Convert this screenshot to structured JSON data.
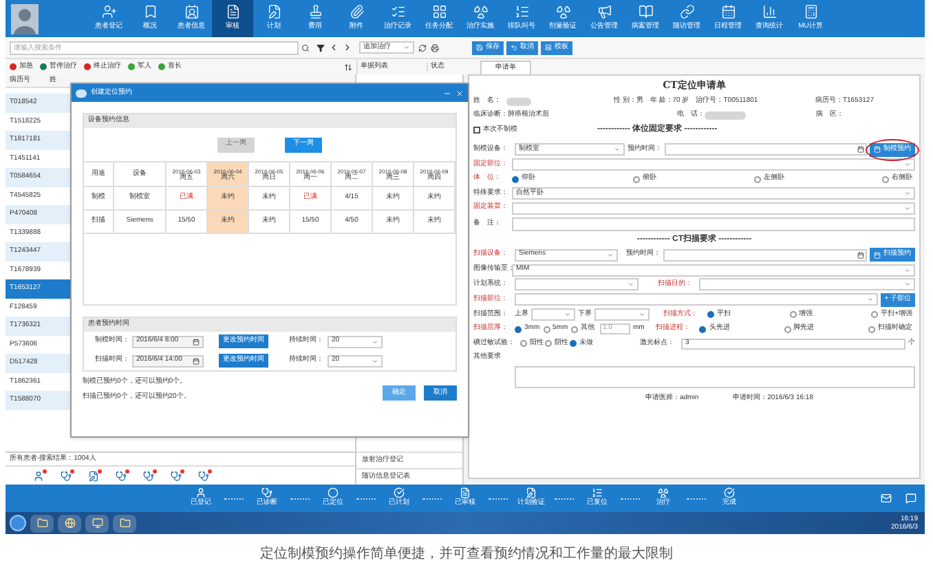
{
  "nav": [
    {
      "label": "患者登记",
      "selected": false
    },
    {
      "label": "概况",
      "selected": false
    },
    {
      "label": "患者信息",
      "selected": false
    },
    {
      "label": "审核",
      "selected": true
    },
    {
      "label": "计划",
      "selected": false
    },
    {
      "label": "费用",
      "selected": false
    },
    {
      "label": "附件",
      "selected": false
    },
    {
      "label": "治疗记录",
      "selected": false
    },
    {
      "label": "任务分配",
      "selected": false
    },
    {
      "label": "治疗实施",
      "selected": false
    },
    {
      "label": "排队叫号",
      "selected": false
    },
    {
      "label": "剂量验证",
      "selected": false
    },
    {
      "label": "公告管理",
      "selected": false
    },
    {
      "label": "病案管理",
      "selected": false
    },
    {
      "label": "随访管理",
      "selected": false
    },
    {
      "label": "日程管理",
      "selected": false
    },
    {
      "label": "查询统计",
      "selected": false
    },
    {
      "label": "MU计算",
      "selected": false
    }
  ],
  "search": {
    "placeholder": "请输入搜索条件"
  },
  "treatment_select": {
    "value": "追加治疗"
  },
  "actions": [
    "保存",
    "取消",
    "模板"
  ],
  "legend": [
    {
      "label": "加急",
      "color": "#d9261c"
    },
    {
      "label": "暂停治疗",
      "color": "#1a7a55"
    },
    {
      "label": "终止治疗",
      "color": "#d9261c"
    },
    {
      "label": "军人",
      "color": "#3aa53a"
    },
    {
      "label": "首长",
      "color": "#3aa53a"
    }
  ],
  "doc_list": {
    "columns": [
      "单据列表",
      "状态"
    ],
    "items": [
      "放射治疗登记",
      "随访信息登记表"
    ]
  },
  "form_tab": {
    "label": "申请单",
    "selected": true
  },
  "patient_list": {
    "columns": [
      "病历号",
      "姓"
    ],
    "rows": [
      {
        "id": "T018542",
        "selected": false
      },
      {
        "id": "T1518225",
        "selected": false
      },
      {
        "id": "T1817181",
        "selected": false
      },
      {
        "id": "T1451141",
        "selected": false
      },
      {
        "id": "T0584654",
        "selected": false
      },
      {
        "id": "T4545825",
        "selected": false
      },
      {
        "id": "P470408",
        "selected": false
      },
      {
        "id": "T1339888",
        "selected": false
      },
      {
        "id": "T1243447",
        "selected": false
      },
      {
        "id": "T1678939",
        "selected": false
      },
      {
        "id": "T1653127",
        "selected": true
      },
      {
        "id": "F128459",
        "selected": false
      },
      {
        "id": "T1736321",
        "selected": false
      },
      {
        "id": "P573606",
        "selected": false
      },
      {
        "id": "D517428",
        "selected": false
      },
      {
        "id": "T1862361",
        "selected": false
      },
      {
        "id": "T1588070",
        "selected": false
      }
    ]
  },
  "result_count": "所有患者-搜索结果：1004人",
  "dialog": {
    "title": "创建定位预约",
    "schedule": {
      "heading": "设备预约信息",
      "prev": {
        "label": "上一周",
        "disabled": true
      },
      "next": {
        "label": "下一周",
        "disabled": false
      },
      "columns": [
        "用途",
        "设备"
      ],
      "days": [
        {
          "date": "2016-06-03",
          "weekday": "周五",
          "selected": false
        },
        {
          "date": "2016-06-04",
          "weekday": "周六",
          "selected": true
        },
        {
          "date": "2016-06-05",
          "weekday": "周日",
          "selected": false
        },
        {
          "date": "2016-06-06",
          "weekday": "周一",
          "selected": false
        },
        {
          "date": "2016-06-07",
          "weekday": "周二",
          "selected": false
        },
        {
          "date": "2016-06-08",
          "weekday": "周三",
          "selected": false
        },
        {
          "date": "2016-06-09",
          "weekday": "周四",
          "selected": false
        }
      ],
      "rows": [
        {
          "use": "制模",
          "device": "制模室",
          "cells": [
            {
              "text": "已满",
              "full": true
            },
            {
              "text": "未约",
              "full": false
            },
            {
              "text": "未约",
              "full": false
            },
            {
              "text": "已满",
              "full": true
            },
            {
              "text": "4/15",
              "full": false
            },
            {
              "text": "未约",
              "full": false
            },
            {
              "text": "未约",
              "full": false
            }
          ]
        },
        {
          "use": "扫描",
          "device": "Siemens",
          "cells": [
            {
              "text": "15/50",
              "full": false
            },
            {
              "text": "未约",
              "full": false
            },
            {
              "text": "未约",
              "full": false
            },
            {
              "text": "15/50",
              "full": false
            },
            {
              "text": "4/50",
              "full": false
            },
            {
              "text": "未约",
              "full": false
            },
            {
              "text": "未约",
              "full": false
            }
          ]
        }
      ]
    },
    "times": {
      "heading": "患者预约时间",
      "rows": [
        {
          "label": "制模时间：",
          "value": "2016/6/4 8:00",
          "button": "更改预约时间",
          "duration_label": "持续时间：",
          "duration": "20"
        },
        {
          "label": "扫描时间：",
          "value": "2016/6/4 14:00",
          "button": "更改预约时间",
          "duration_label": "持续时间：",
          "duration": "20"
        }
      ]
    },
    "notes": [
      "制模已预约0个，还可以预约0个。",
      "扫描已预约0个，还可以预约20个。"
    ],
    "ok": "确定",
    "cancel": "取消"
  },
  "form": {
    "title": "CT定位申请单",
    "name_label": "姓　名：",
    "gender": "性 别：男",
    "age": "年 龄：70 岁",
    "treatment_no": "治疗号：T00511801",
    "record_no": "病历号：T1653127",
    "diagnosis": "临床诊断：肺癌根治术后",
    "phone_label": "电　话：",
    "ward": "病　区：",
    "skip_mold": {
      "label": "本次不制模",
      "checked": false
    },
    "fix_heading": "------------ 体位固定要求 ------------",
    "mold_device": {
      "label": "制模设备：",
      "required": false,
      "value": "制模室"
    },
    "mold_time": {
      "label": "预约时间："
    },
    "mold_button": "制模预约",
    "fix_part": {
      "label": "固定部位：",
      "required": true
    },
    "posture": {
      "label": "体　位：",
      "required": true,
      "options": [
        {
          "label": "仰卧",
          "selected": true
        },
        {
          "label": "俯卧",
          "selected": false
        },
        {
          "label": "左侧卧",
          "selected": false
        },
        {
          "label": "右侧卧",
          "selected": false
        }
      ]
    },
    "special": {
      "label": "特殊要求：",
      "required": false,
      "value": "自然平卧"
    },
    "fix_device": {
      "label": "固定装置：",
      "required": true
    },
    "note": {
      "label": "备　注：",
      "required": false
    },
    "ct_heading": "------------ CT扫描要求 ------------",
    "scan_device": {
      "label": "扫描设备：",
      "required": true,
      "value": "Siemens"
    },
    "scan_time": {
      "label": "预约时间："
    },
    "scan_button": "扫描预约",
    "transfer": {
      "label": "图像传输至：",
      "required": false,
      "value": "MIM"
    },
    "plan_system": {
      "label": "计划系统：",
      "required": false
    },
    "scan_goal": {
      "label": "扫描目的：",
      "required": true
    },
    "scan_part": {
      "label": "扫描部位：",
      "required": true
    },
    "sub_part_button": "+ 子部位",
    "range": {
      "label": "扫描范围：",
      "required": false,
      "upper": "上界",
      "lower": "下界"
    },
    "scan_mode": {
      "label": "扫描方式：",
      "required": true,
      "options": [
        {
          "label": "平扫",
          "selected": true
        },
        {
          "label": "增强",
          "selected": false
        },
        {
          "label": "平扫+增强",
          "selected": false
        }
      ]
    },
    "thickness": {
      "label": "扫描层厚：",
      "required": true,
      "options": [
        {
          "label": "3mm",
          "selected": true
        },
        {
          "label": "5mm",
          "selected": false
        },
        {
          "label": "其他",
          "selected": false
        }
      ],
      "other_value": "1.0",
      "unit": "mm"
    },
    "scan_order": {
      "label": "扫描进程：",
      "required": true,
      "options": [
        {
          "label": "头先进",
          "selected": true
        },
        {
          "label": "脚先进",
          "selected": false
        },
        {
          "label": "扫描时确定",
          "selected": false
        }
      ]
    },
    "iodine": {
      "label": "碘过敏试验：",
      "required": false,
      "options": [
        {
          "label": "阳性",
          "selected": false
        },
        {
          "label": "阴性",
          "selected": false
        },
        {
          "label": "未做",
          "selected": true
        }
      ]
    },
    "laser": {
      "label": "激光标点：",
      "required": false,
      "value": "3",
      "unit": "个"
    },
    "other": {
      "label": "其他要求"
    },
    "doctor": "申请医师：admin",
    "apply_time": "申请时间：2016/6/3 16:18"
  },
  "workflow": [
    "已登记",
    "已诊断",
    "已定位",
    "已计划",
    "已审核",
    "计划验证",
    "已复位",
    "治疗",
    "完成"
  ],
  "taskbar": {
    "time": "16:19",
    "date": "2016/6/3"
  },
  "caption": "定位制模预约操作简单便捷，并可查看预约情况和工作量的最大限制"
}
